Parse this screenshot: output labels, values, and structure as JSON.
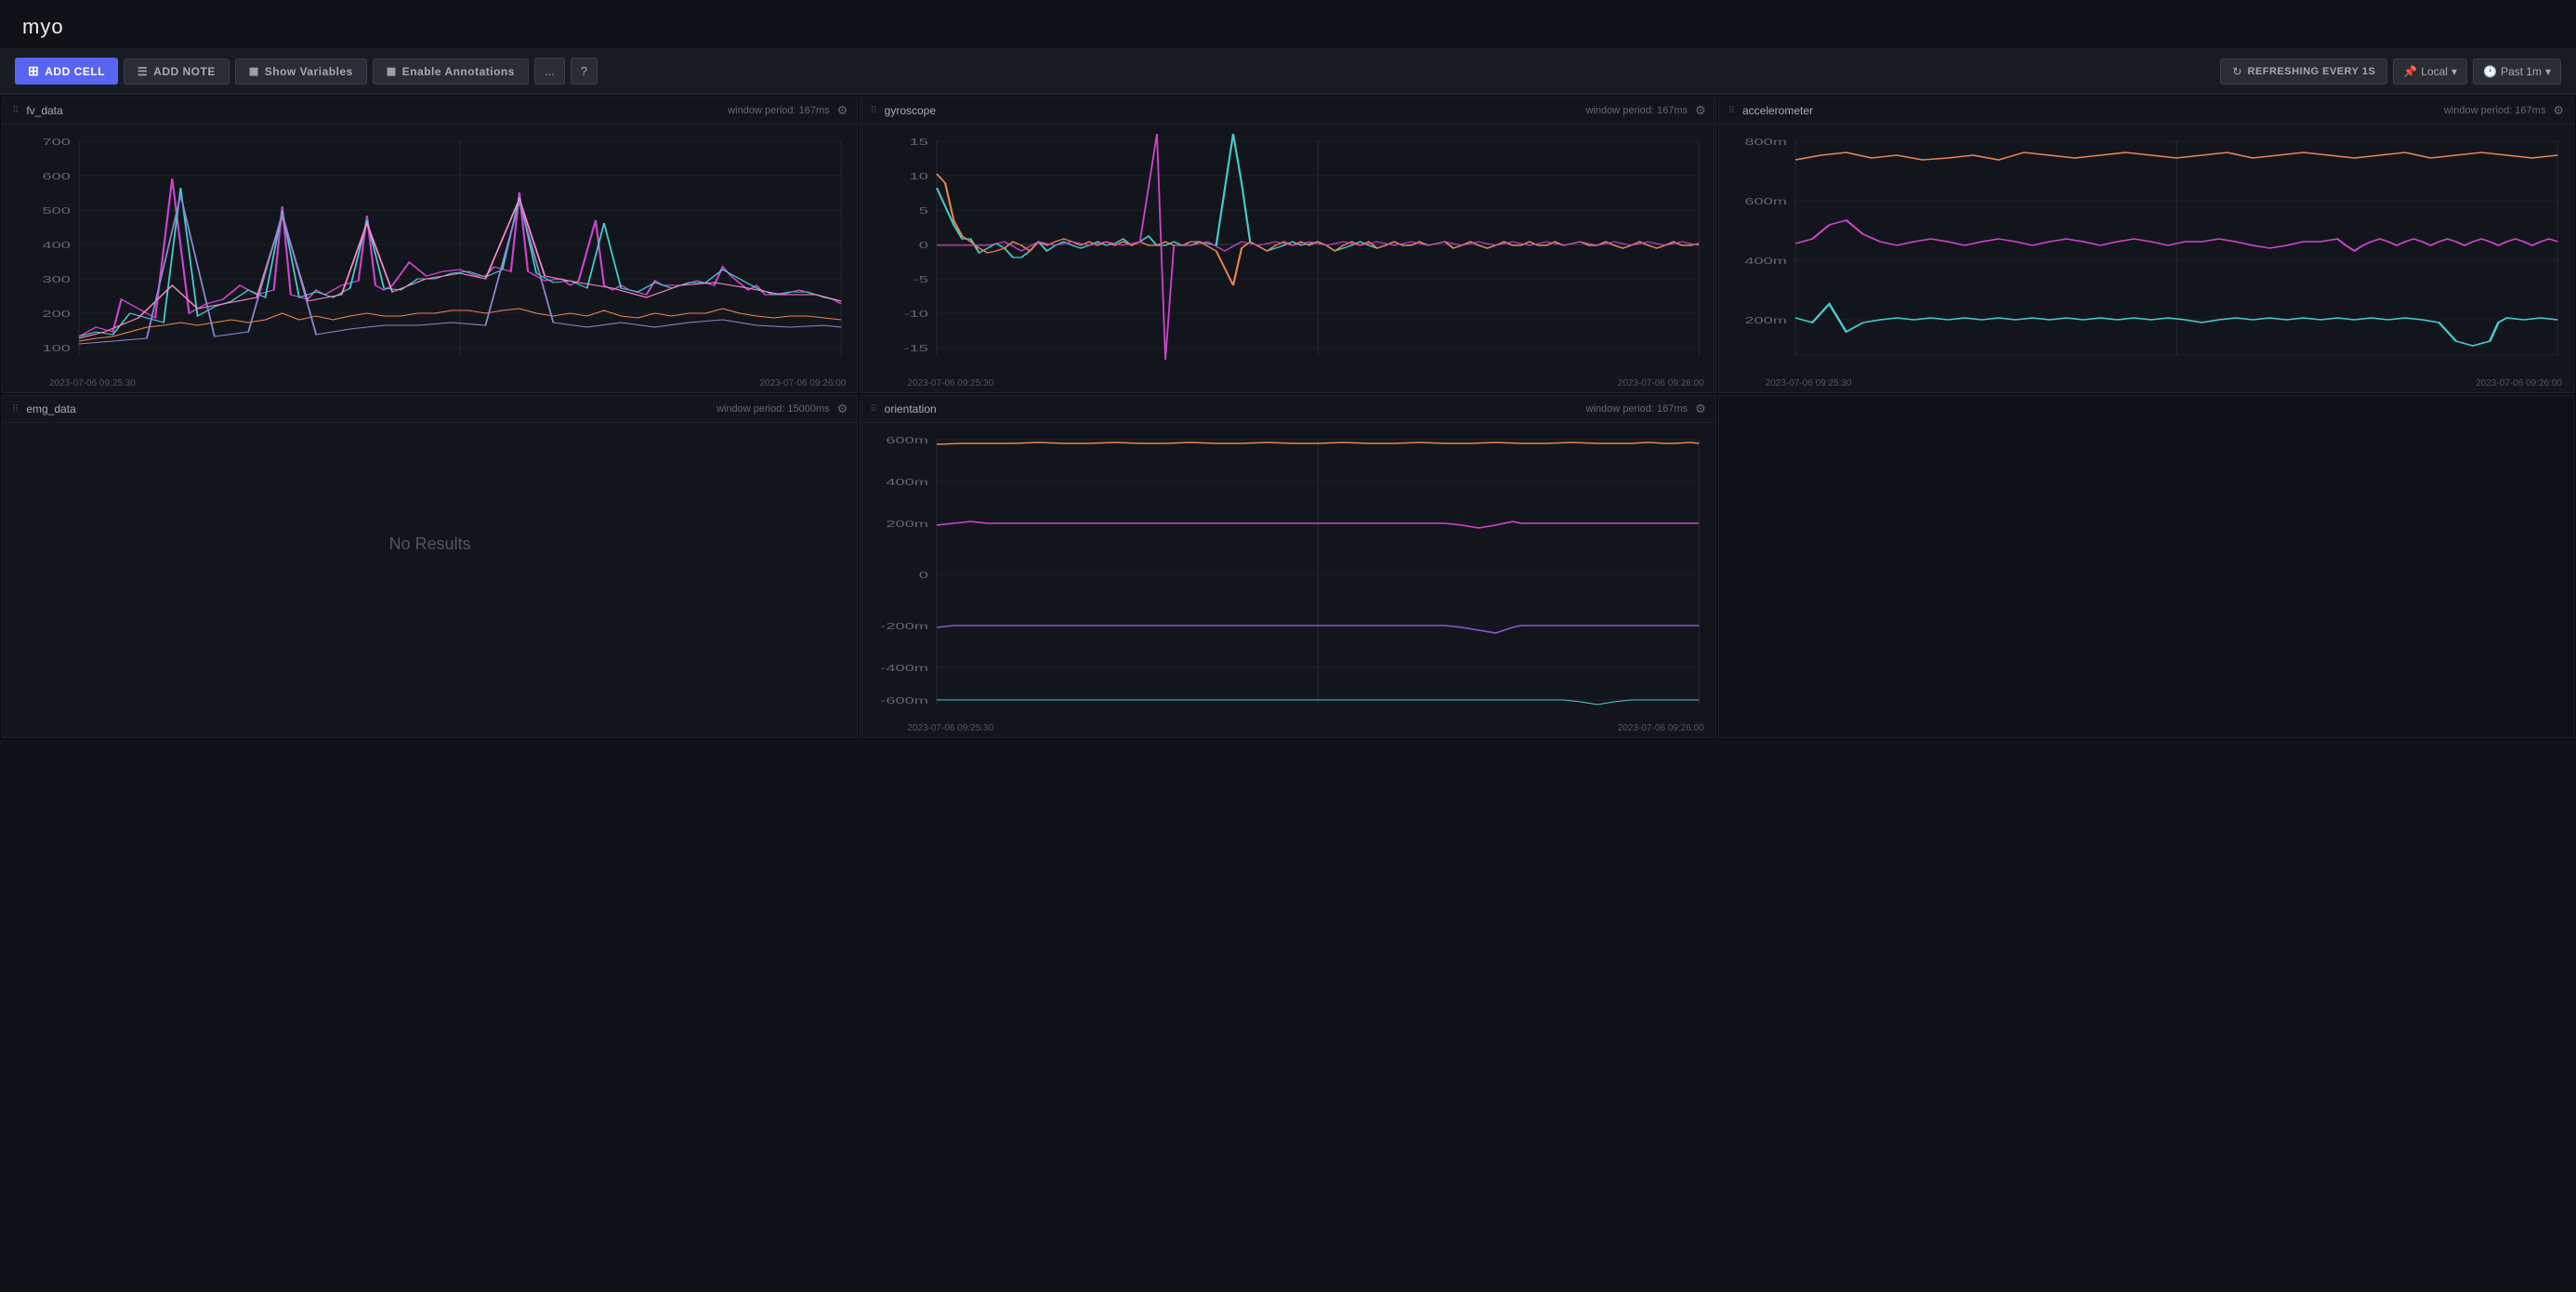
{
  "app": {
    "title": "myo"
  },
  "toolbar": {
    "add_cell_label": "ADD CELL",
    "add_note_label": "ADD NOTE",
    "show_variables_label": "Show Variables",
    "enable_annotations_label": "Enable Annotations",
    "more_label": "...",
    "help_label": "?",
    "refresh_label": "REFRESHING EVERY 1S",
    "local_label": "Local",
    "time_range_label": "Past 1m"
  },
  "cells": [
    {
      "id": "fv_data",
      "title": "fv_data",
      "period": "window period: 167ms",
      "type": "chart",
      "yLabels": [
        "700",
        "600",
        "500",
        "400",
        "300",
        "200",
        "100"
      ],
      "xLabels": [
        "2023-07-06 09:25:30",
        "2023-07-06 09:26:00"
      ],
      "col": 1
    },
    {
      "id": "gyroscope",
      "title": "gyroscope",
      "period": "window period: 167ms",
      "type": "chart",
      "yLabels": [
        "15",
        "10",
        "5",
        "0",
        "-5",
        "-10",
        "-15"
      ],
      "xLabels": [
        "2023-07-06 09:25:30",
        "2023-07-06 09:26:00"
      ],
      "col": 2
    },
    {
      "id": "accelerometer",
      "title": "accelerometer",
      "period": "window period: 167ms",
      "type": "chart",
      "yLabels": [
        "800m",
        "600m",
        "400m",
        "200m"
      ],
      "xLabels": [
        "2023-07-06 09:25:30",
        "2023-07-06 09:26:00"
      ],
      "col": 3
    },
    {
      "id": "emg_data",
      "title": "emg_data",
      "period": "window period: 15000ms",
      "type": "no_results",
      "noResultsText": "No Results",
      "col": 1
    },
    {
      "id": "orientation",
      "title": "orientation",
      "period": "window period: 167ms",
      "type": "chart",
      "yLabels": [
        "600m",
        "400m",
        "200m",
        "0",
        "-200m",
        "-400m",
        "-600m"
      ],
      "xLabels": [
        "2023-07-06 09:25:30",
        "2023-07-06 09:26:00"
      ],
      "col": 2
    }
  ],
  "colors": {
    "bg": "#111217",
    "toolbar_bg": "#181b22",
    "cell_bg": "#13151c",
    "border": "#1e2028",
    "accent_blue": "#5865f2",
    "line1": "#e8834e",
    "line2": "#cc44cc",
    "line3": "#44cccc",
    "line4": "#8888cc",
    "line5": "#ffaa44",
    "line6": "#44aaff"
  }
}
